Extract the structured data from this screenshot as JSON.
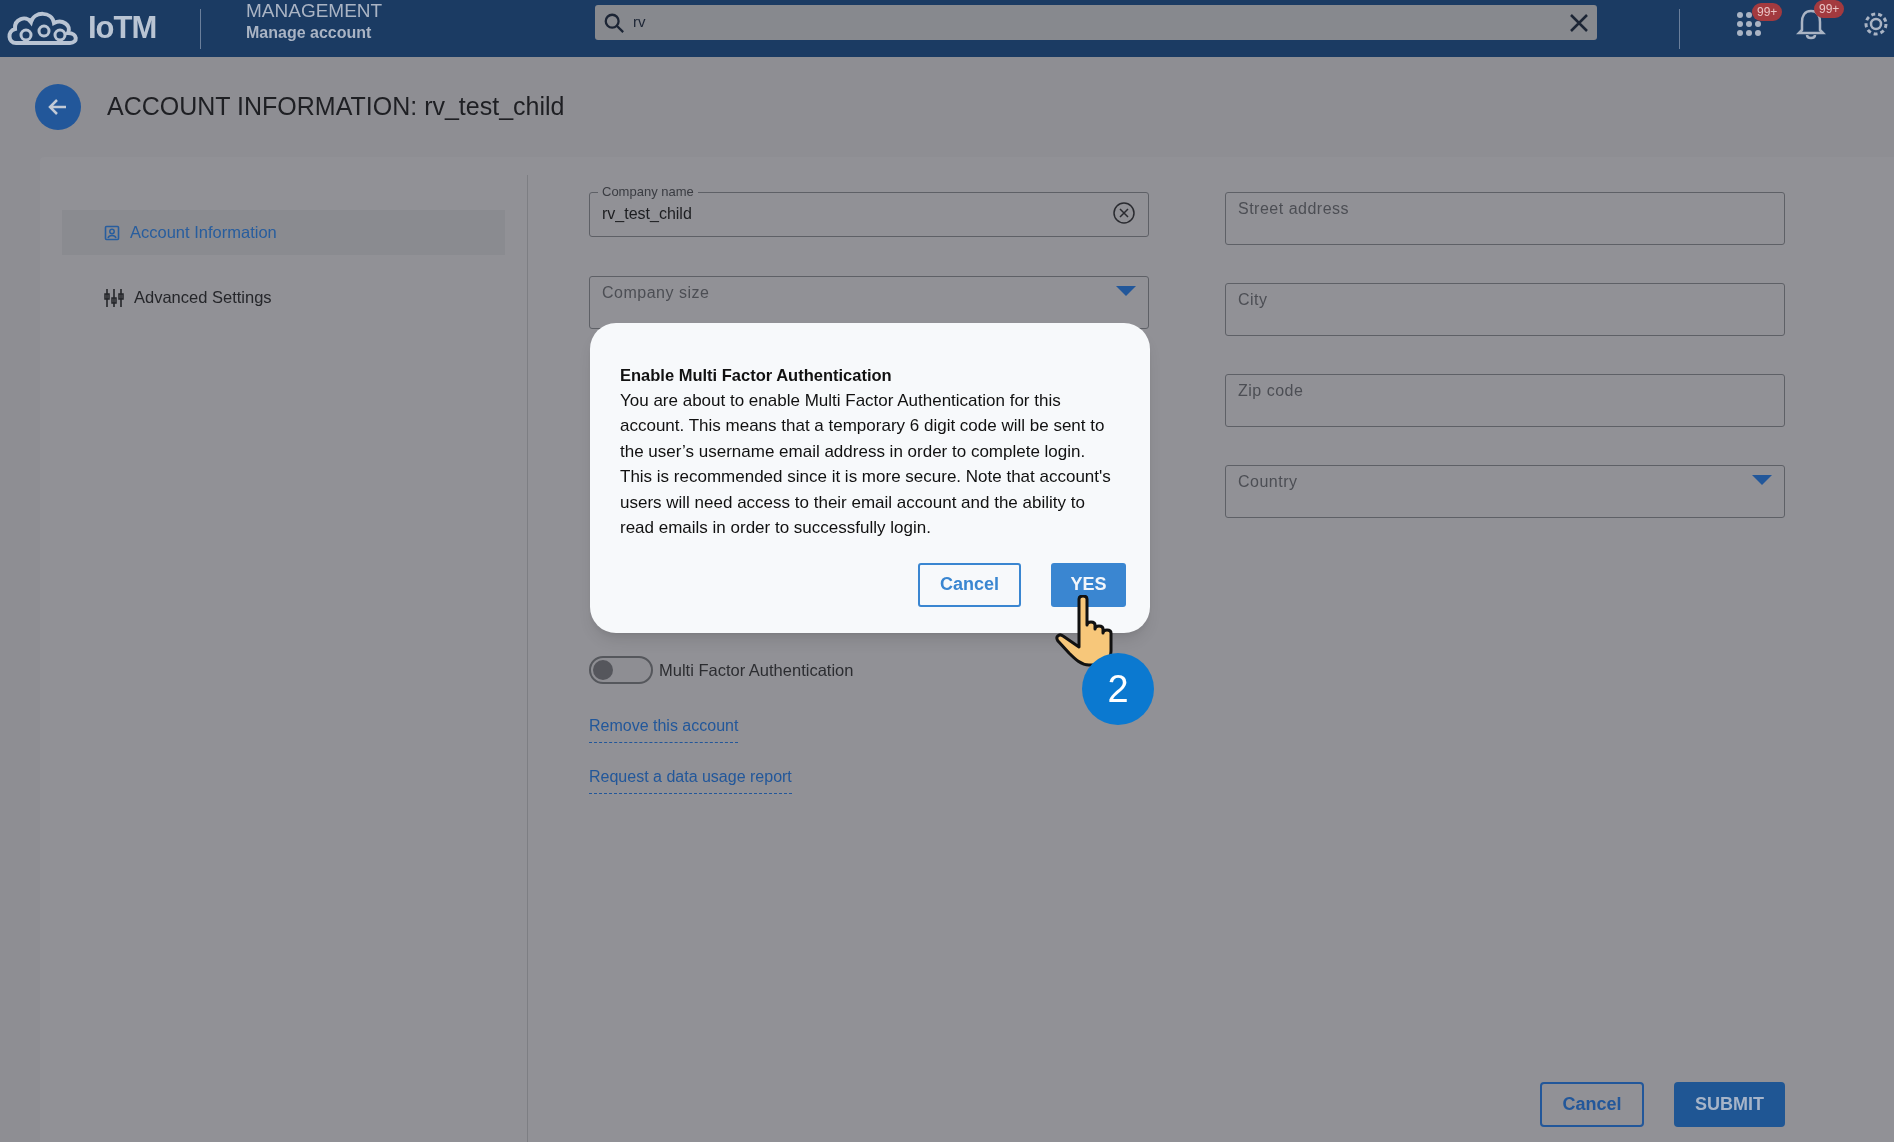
{
  "header": {
    "logo_text": "IoTM",
    "section": "MANAGEMENT",
    "subtitle": "Manage account",
    "search": {
      "value": "rv"
    },
    "badges": [
      "99+",
      "99+"
    ]
  },
  "page_title": "ACCOUNT INFORMATION: rv_test_child",
  "sidebar": {
    "items": [
      {
        "label": "Account Information",
        "selected": true,
        "kind": "account"
      },
      {
        "label": "Advanced Settings",
        "selected": false,
        "kind": "settings"
      }
    ]
  },
  "form": {
    "left_fields": [
      {
        "kind": "text",
        "label": "Company name",
        "value": "rv_test_child"
      },
      {
        "kind": "select",
        "placeholder": "Company size"
      }
    ],
    "right_fields": [
      {
        "kind": "text",
        "placeholder": "Street address"
      },
      {
        "kind": "text",
        "placeholder": "City"
      },
      {
        "kind": "text",
        "placeholder": "Zip code"
      },
      {
        "kind": "select",
        "placeholder": "Country"
      }
    ],
    "toggle": {
      "label": "Multi Factor Authentication",
      "on": false
    },
    "links": [
      "Remove this account",
      "Request a data usage report"
    ]
  },
  "dialog": {
    "title": "Enable Multi Factor Authentication",
    "body": "You are about to enable Multi Factor Authentication for this account. This means that a temporary 6 digit code will be sent to the user’s username email address in order to complete login. This is recommended since it is more secure. Note that account's users will need access to their email account and the ability to read emails in order to successfully login.",
    "cancel": "Cancel",
    "confirm": "YES"
  },
  "tutorial_step": "2",
  "footer": {
    "cancel": "Cancel",
    "submit": "SUBMIT"
  }
}
